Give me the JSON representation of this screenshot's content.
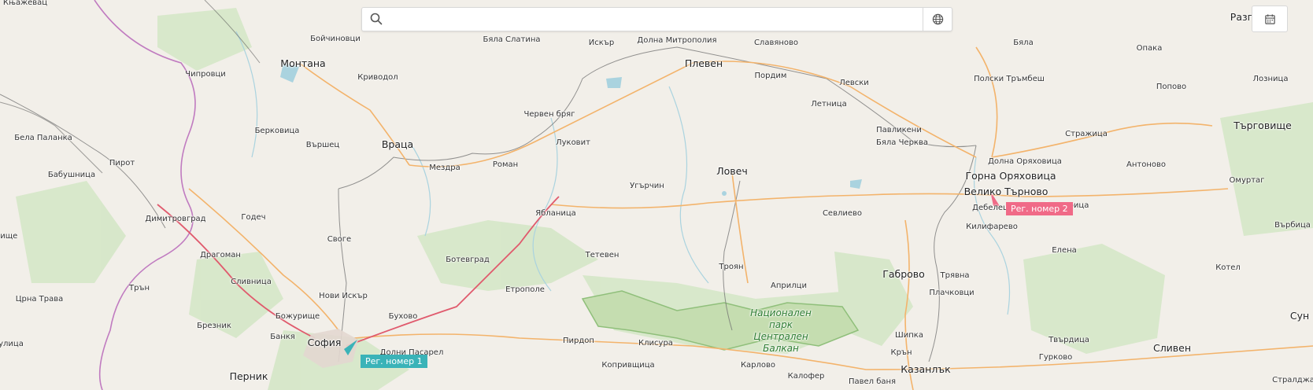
{
  "search": {
    "placeholder": "",
    "value": ""
  },
  "controls": {
    "language_icon": "globe-icon",
    "calendar_icon": "calendar-icon",
    "search_icon": "search-icon"
  },
  "colors": {
    "marker1": "#3ab3b8",
    "marker2": "#f06a87",
    "background": "#f2efe9",
    "park": "#c8dfb8",
    "primary_road": "#f3b36b",
    "trunk_road": "#e05a6d",
    "border": "#c07bc0",
    "water": "#aad3df"
  },
  "markers": [
    {
      "label": "Рег. номер 1",
      "color": "#3ab3b8"
    },
    {
      "label": "Рег. номер 2",
      "color": "#f06a87"
    }
  ],
  "places": {
    "knyazhevac": "Књажевац",
    "boychinovtsi": "Бойчиновци",
    "byala_slatina": "Бяла Слатина",
    "iskar": "Искър",
    "dolna_mitropoliya": "Долна Митрополия",
    "slavyanovo": "Славяново",
    "montana": "Монтана",
    "pleven": "Плевен",
    "byala_north": "Бяла",
    "razgrad": "Разг",
    "opaka": "Опака",
    "chiprovtsi": "Чипровци",
    "krivodol": "Криводол",
    "pordim": "Пордим",
    "levski": "Левски",
    "polski_trambesh": "Полски Тръмбеш",
    "popovo": "Попово",
    "loznitsa": "Лозница",
    "letnitsa": "Летница",
    "cherven_bryag": "Червен бряг",
    "berkovitsa": "Берковица",
    "pavlikeni": "Павликени",
    "bela_palanka": "Бела Паланка",
    "vratsa": "Враца",
    "lukovit": "Луковит",
    "varshets": "Вършец",
    "byala_cherkva": "Бяла Черква",
    "strazhitsa": "Стражица",
    "targovishte": "Търговище",
    "pirot": "Пирот",
    "mezdra": "Мездра",
    "roman": "Роман",
    "dolna_oryahovitsa": "Долна Оряховица",
    "antonovo": "Антоново",
    "lovech": "Ловеч",
    "gorna_oryahovitsa": "Горна Оряховица",
    "babushnitsa": "Бабушница",
    "omurtag": "Омуртаг",
    "ugarchin": "Угърчин",
    "veliko_tarnovo": "Велико Търново",
    "dimitrovgrad": "Димитровград",
    "yablanitsa": "Ябланица",
    "sevlievo": "Севлиево",
    "debelets": "Дебелец",
    "zlataritsa": "Златарица",
    "godech": "Годеч",
    "kilifarevo": "Килифарево",
    "varbitsa": "Върбица",
    "svoge": "Своге",
    "nishe": "нище",
    "elena": "Елена",
    "dragoman": "Драгоман",
    "teteven": "Тетевен",
    "botevgrad": "Ботевград",
    "gabrovo": "Габрово",
    "troyan": "Троян",
    "slivnitsa": "Сливница",
    "tryavna": "Трявна",
    "kotel": "Котел",
    "tran": "Трън",
    "etropole": "Етрополе",
    "apriltsi": "Априлци",
    "plachkovtsi": "Плачковци",
    "tsrna_trava": "Црна Трава",
    "novi_iskar": "Нови Искър",
    "bozhurishte": "Божурище",
    "buhovo": "Бухово",
    "brezhnik": "Брезник",
    "park_name": "Национален парк Централен Балкан",
    "sun": "Сун",
    "bankya": "Банкя",
    "sofia": "София",
    "pirdop": "Пирдоп",
    "klisura": "Клисура",
    "shipka": "Шипка",
    "tvarditsa": "Твърдица",
    "sliven": "Сливен",
    "ulitsa": "улица",
    "dolni_pasarel": "Долни Пасарел",
    "kran": "Крън",
    "gurkovo": "Гурково",
    "karlovo": "Карлово",
    "koprivshtitsa": "Копривщица",
    "kazanlak": "Казанлък",
    "pernik": "Перник",
    "kalofer": "Калофер",
    "pavel_banya": "Павел баня",
    "stralja": "Стралджа"
  }
}
